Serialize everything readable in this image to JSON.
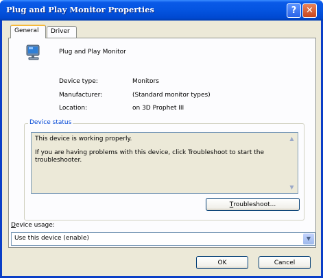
{
  "window": {
    "title": "Plug and Play Monitor Properties",
    "help_glyph": "?",
    "close_glyph": "✕"
  },
  "tabs": [
    {
      "label": "General",
      "active": true
    },
    {
      "label": "Driver",
      "active": false
    }
  ],
  "device": {
    "icon": "monitor-icon",
    "name": "Plug and Play Monitor",
    "properties": [
      {
        "label": "Device type:",
        "value": "Monitors"
      },
      {
        "label": "Manufacturer:",
        "value": "(Standard monitor types)"
      },
      {
        "label": "Location:",
        "value": "on 3D Prophet III"
      }
    ]
  },
  "status": {
    "group_title": "Device status",
    "line1": "This device is working properly.",
    "line2": "If you are having problems with this device, click Troubleshoot to start the troubleshooter.",
    "troubleshoot_mnemonic": "T",
    "troubleshoot_rest": "roubleshoot..."
  },
  "usage": {
    "label_mnemonic": "D",
    "label_rest": "evice usage:",
    "selected": "Use this device (enable)"
  },
  "buttons": {
    "ok": "OK",
    "cancel": "Cancel"
  },
  "colors": {
    "titlebar": "#0454e0",
    "group_title": "#0046d5",
    "close_button": "#c8451c"
  }
}
